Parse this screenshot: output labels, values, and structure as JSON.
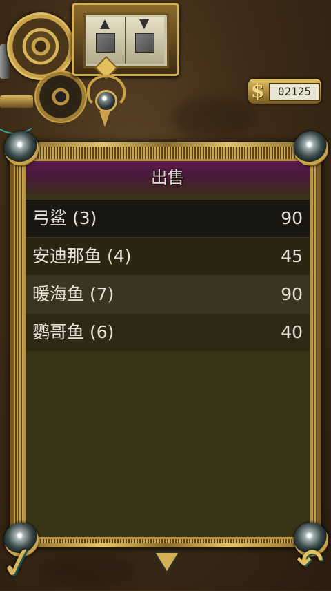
{
  "money": {
    "sign": "$",
    "amount": "02125"
  },
  "panel": {
    "title": "出售"
  },
  "sell_items": [
    {
      "name": "弓鲨 (3)",
      "price": "90",
      "bg": "#181712"
    },
    {
      "name": "安迪那鱼 (4)",
      "price": "45",
      "bg": "#2a2612"
    },
    {
      "name": "暖海鱼 (7)",
      "price": "90",
      "bg": "#3a3520"
    },
    {
      "name": "鹦哥鱼 (6)",
      "price": "40",
      "bg": "#2d2914"
    }
  ],
  "controls": {
    "confirm_symbol": "✓",
    "back_symbol": "↶"
  },
  "icons": {
    "tool_up": "box-arrow-up-icon",
    "tool_down": "box-arrow-down-icon",
    "confirm": "checkmark-icon",
    "scroll": "chevron-down-icon",
    "back": "undo-arrow-icon"
  },
  "colors": {
    "accent_gold": "#d4b055",
    "header_purple": "#5c1a4c",
    "panel_bg": "#393418"
  }
}
